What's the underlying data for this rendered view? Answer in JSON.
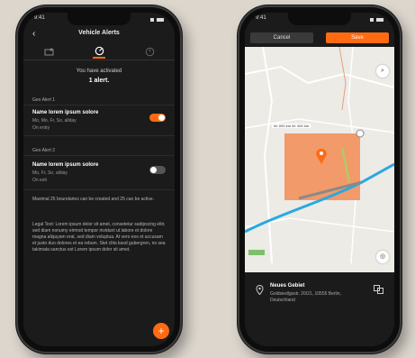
{
  "left_phone": {
    "status_time": "9:41",
    "header": {
      "back_icon": "back-arrow-icon",
      "title": "Vehicle Alerts"
    },
    "tabs": [
      "geo-fence-icon",
      "speed-gauge-icon",
      "time-gauge-icon"
    ],
    "activated_text": "You have activated",
    "activated_count": "1 alert.",
    "alerts": [
      {
        "section": "Geo Alert 1",
        "name": "Name lorem ipsum solore",
        "days": "Mo, Mo, Fr, So, allday",
        "state": "On entry",
        "enabled": true
      },
      {
        "section": "Geo Alert 2",
        "name": "Name lorem ipsum solore",
        "days": "Mo, Fr, So, allday",
        "state": "On exit",
        "enabled": false
      }
    ],
    "limit_text": "Maximal 25 boundaries can be created and 25 can be active.",
    "legal_text": "Legal Text: Lorem ipsum dolor sit amet, consetetur sadipscing elitr, sed diam nonumy eirmod tempor invidunt ut labore et dolore magna aliquyam erat, sed diam voluptua. At vero eos et accusam et justo duo dolores et ea rebum. Stet clita kasd gubergren, no sea takimata sanctus est Lorem ipsum dolor sit amet.",
    "fab_label": "+"
  },
  "right_phone": {
    "status_time": "9:41",
    "cancel_label": "Cancel",
    "save_label": "Save",
    "map_dims": "W: 000 km  W: 000 km",
    "place_name": "Neues Gebiet",
    "place_address": "Goldsiedlgsstr. 20/21, 10555 Berlin, Deutschland",
    "colors": {
      "accent": "#ff6a13",
      "zone": "#f2925e",
      "road": "#29a9e0"
    }
  }
}
